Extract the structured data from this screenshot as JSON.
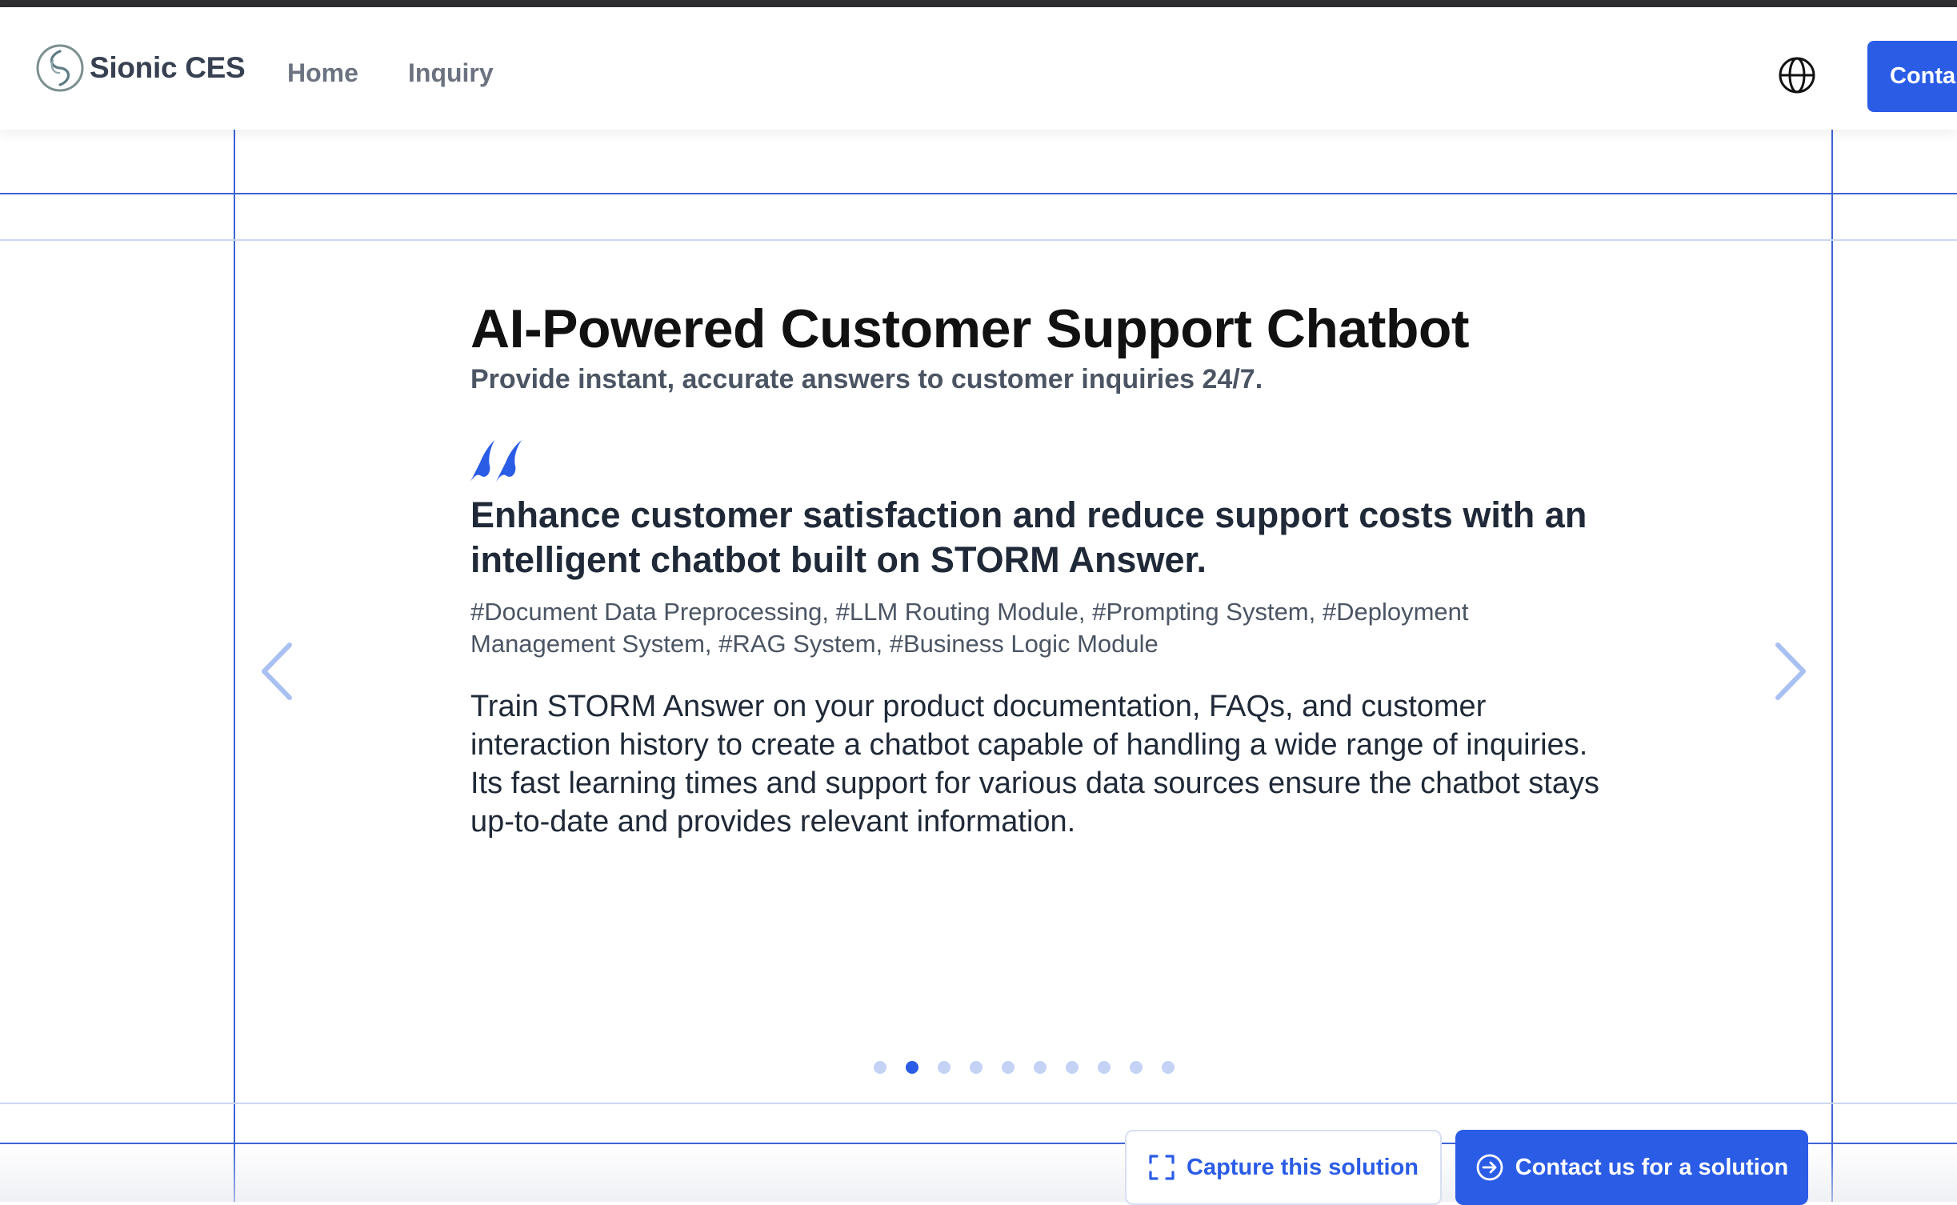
{
  "header": {
    "brand": "Sionic CES",
    "nav": {
      "home": "Home",
      "inquiry": "Inquiry"
    },
    "language_icon": "globe-icon",
    "contact_label": "Conta"
  },
  "slide": {
    "title": "AI-Powered Customer Support Chatbot",
    "subtitle": "Provide instant, accurate answers to customer inquiries 24/7.",
    "quote_icon": "quote-icon",
    "quote": "Enhance customer satisfaction and reduce support costs with an intelligent chatbot built on STORM Answer.",
    "tags": "#Document Data Preprocessing, #LLM Routing Module, #Prompting System, #Deployment Management System, #RAG System, #Business Logic Module",
    "description": "Train STORM Answer on your product documentation, FAQs, and customer interaction history to create a chatbot capable of handling a wide range of inquiries. Its fast learning times and support for various data sources ensure the chatbot stays up-to-date and provides relevant information."
  },
  "carousel": {
    "total_slides": 10,
    "active_index": 1,
    "prev_icon": "chevron-left-icon",
    "next_icon": "chevron-right-icon"
  },
  "actions": {
    "capture_label": "Capture this solution",
    "contact_label": "Contact us for a solution"
  },
  "colors": {
    "accent": "#2b5ce6",
    "grid_line": "#3e64d6",
    "grid_line_light": "#cdd7f3",
    "dot_inactive": "#c4d2f5"
  }
}
